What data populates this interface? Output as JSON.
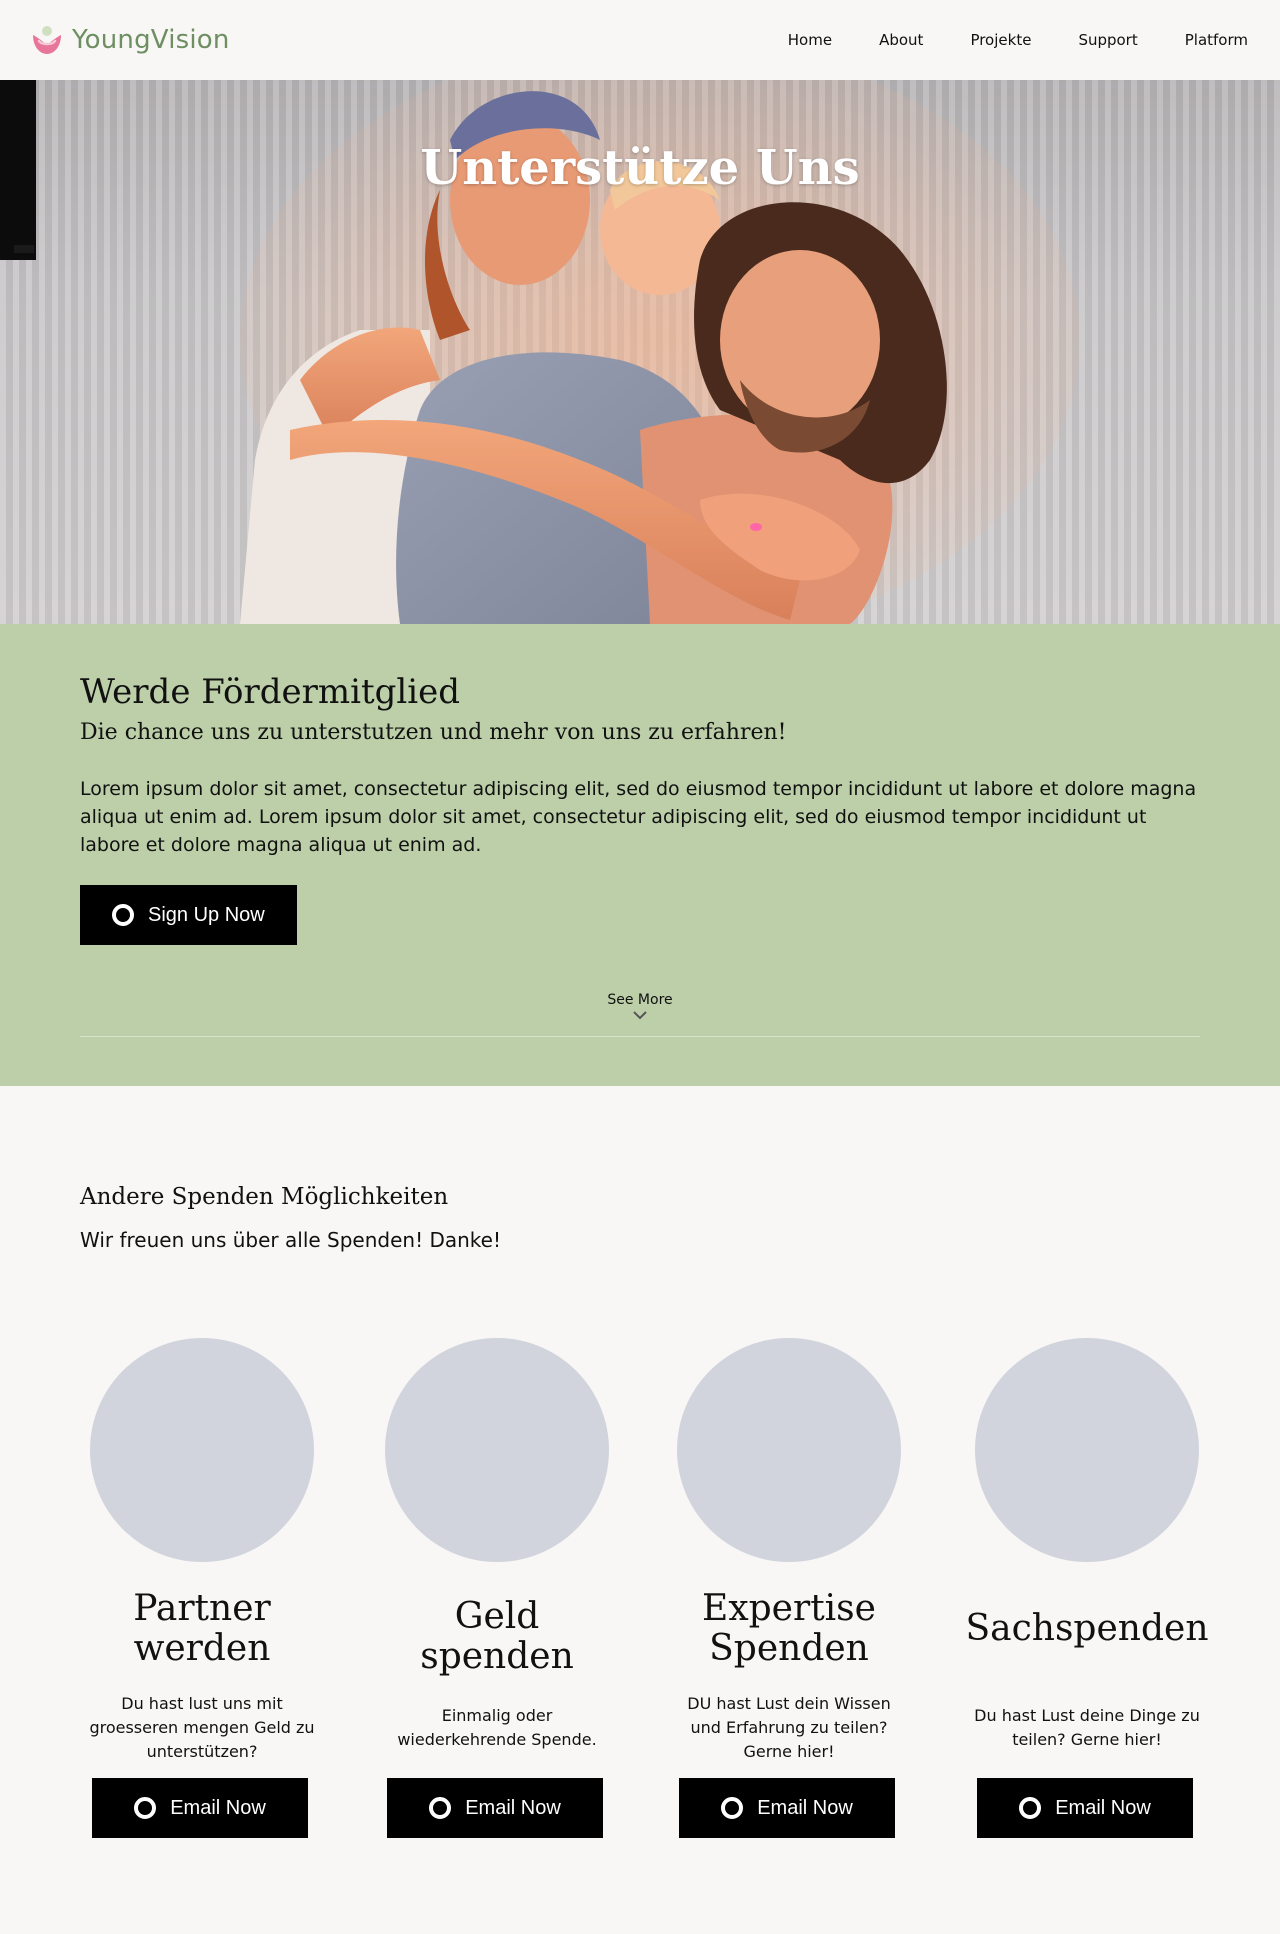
{
  "header": {
    "brand_name": "YoungVision",
    "nav": [
      "Home",
      "About",
      "Projekte",
      "Support",
      "Platform"
    ]
  },
  "hero": {
    "title": "Unterstütze Uns"
  },
  "membership": {
    "title": "Werde Fördermitglied",
    "subtitle": "Die chance uns zu unterstutzen und mehr von uns zu erfahren!",
    "body": "Lorem ipsum dolor sit amet, consectetur adipiscing elit, sed do eiusmod tempor incididunt ut labore et dolore magna aliqua ut enim ad. Lorem ipsum dolor sit amet, consectetur adipiscing elit, sed do eiusmod tempor incididunt ut labore et dolore magna aliqua ut enim ad.",
    "cta_label": "Sign Up Now",
    "see_more": "See More"
  },
  "donations": {
    "title": "Andere Spenden Möglichkeiten",
    "subtitle": "Wir freuen uns über alle Spenden! Danke!",
    "cards": [
      {
        "title": "Partner werden",
        "desc": "Du hast lust uns mit groesseren mengen Geld zu unterstützen?",
        "button": "Email Now"
      },
      {
        "title": "Geld spenden",
        "desc": "Einmalig oder wiederkehrende Spende.",
        "button": "Email Now"
      },
      {
        "title": "Expertise Spenden",
        "desc": "DU hast Lust dein Wissen und Erfahrung zu teilen? Gerne hier!",
        "button": "Email Now"
      },
      {
        "title": "Sachspenden",
        "desc": "Du hast Lust deine Dinge zu teilen? Gerne hier!",
        "button": "Email Now"
      }
    ]
  },
  "colors": {
    "brand_green": "#6e8f62",
    "brand_pink": "#e8769a",
    "section_green": "#bccfa8",
    "page_bg": "#f8f7f5",
    "placeholder_gray": "#d1d4dc",
    "button_black": "#000000"
  },
  "icons": {
    "logo": "heart-sprout-icon",
    "button": "ring-icon",
    "see_more": "chevron-down-icon"
  }
}
